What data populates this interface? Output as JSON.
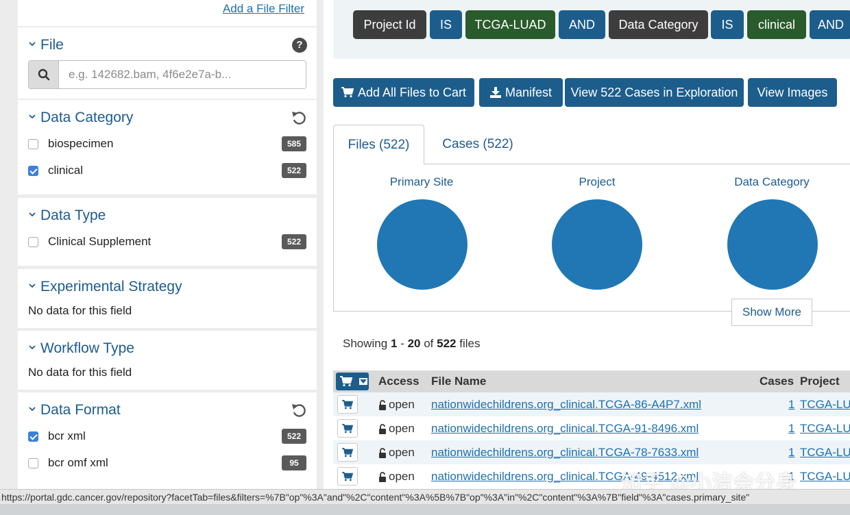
{
  "sidebar": {
    "add_filter": "Add a File Filter",
    "file": {
      "title": "File",
      "search_placeholder": "e.g. 142682.bam, 4f6e2e7a-b..."
    },
    "data_category": {
      "title": "Data Category",
      "items": [
        {
          "label": "biospecimen",
          "count": "585",
          "checked": false
        },
        {
          "label": "clinical",
          "count": "522",
          "checked": true
        }
      ]
    },
    "data_type": {
      "title": "Data Type",
      "items": [
        {
          "label": "Clinical Supplement",
          "count": "522",
          "checked": false
        }
      ]
    },
    "experimental_strategy": {
      "title": "Experimental Strategy",
      "empty": "No data for this field"
    },
    "workflow_type": {
      "title": "Workflow Type",
      "empty": "No data for this field"
    },
    "data_format": {
      "title": "Data Format",
      "items": [
        {
          "label": "bcr xml",
          "count": "522",
          "checked": true
        },
        {
          "label": "bcr omf xml",
          "count": "95",
          "checked": false
        }
      ]
    }
  },
  "query": {
    "pills": [
      "Project Id",
      "IS",
      "TCGA-LUAD",
      "AND",
      "Data Category",
      "IS",
      "clinical",
      "AND"
    ]
  },
  "actions": {
    "add_all": "Add All Files to Cart",
    "manifest": "Manifest",
    "view_cases": "View 522 Cases in Exploration",
    "view_images": "View Images"
  },
  "tabs": {
    "files": "Files (522)",
    "cases": "Cases (522)"
  },
  "charts": {
    "primary_site": "Primary Site",
    "project": "Project",
    "data_category": "Data Category",
    "show_more": "Show More"
  },
  "showing": {
    "prefix": "Showing",
    "from": "1",
    "dash": "-",
    "to": "20",
    "of": "of",
    "total": "522",
    "suffix": "files"
  },
  "table": {
    "headers": {
      "access": "Access",
      "file_name": "File Name",
      "cases": "Cases",
      "project": "Project"
    },
    "rows": [
      {
        "access": "open",
        "file_name": "nationwidechildrens.org_clinical.TCGA-86-A4P7.xml",
        "cases": "1",
        "project": "TCGA-LUAD"
      },
      {
        "access": "open",
        "file_name": "nationwidechildrens.org_clinical.TCGA-91-8496.xml",
        "cases": "1",
        "project": "TCGA-LUAD"
      },
      {
        "access": "open",
        "file_name": "nationwidechildrens.org_clinical.TCGA-78-7633.xml",
        "cases": "1",
        "project": "TCGA-LUAD"
      },
      {
        "access": "open",
        "file_name": "nationwidechildrens.org_clinical.TCGA-49-4512.xml",
        "cases": "1",
        "project": "TCGA-LUAD"
      }
    ]
  },
  "status_url": "https://portal.gdc.cancer.gov/repository?facetTab=files&filters=%7B\"op\"%3A\"and\"%2C\"content\"%3A%5B%7B\"op\"%3A\"in\"%2C\"content\"%3A%7B\"field\"%3A\"cases.primary_site\"",
  "watermark": "知乎 @小洁会分身",
  "colors": {
    "accent": "#1c5d8c",
    "link": "#1d6fb3",
    "pie": "#2077b4",
    "dark_pill": "#3d3d3d",
    "green_pill": "#2a5b2c"
  }
}
